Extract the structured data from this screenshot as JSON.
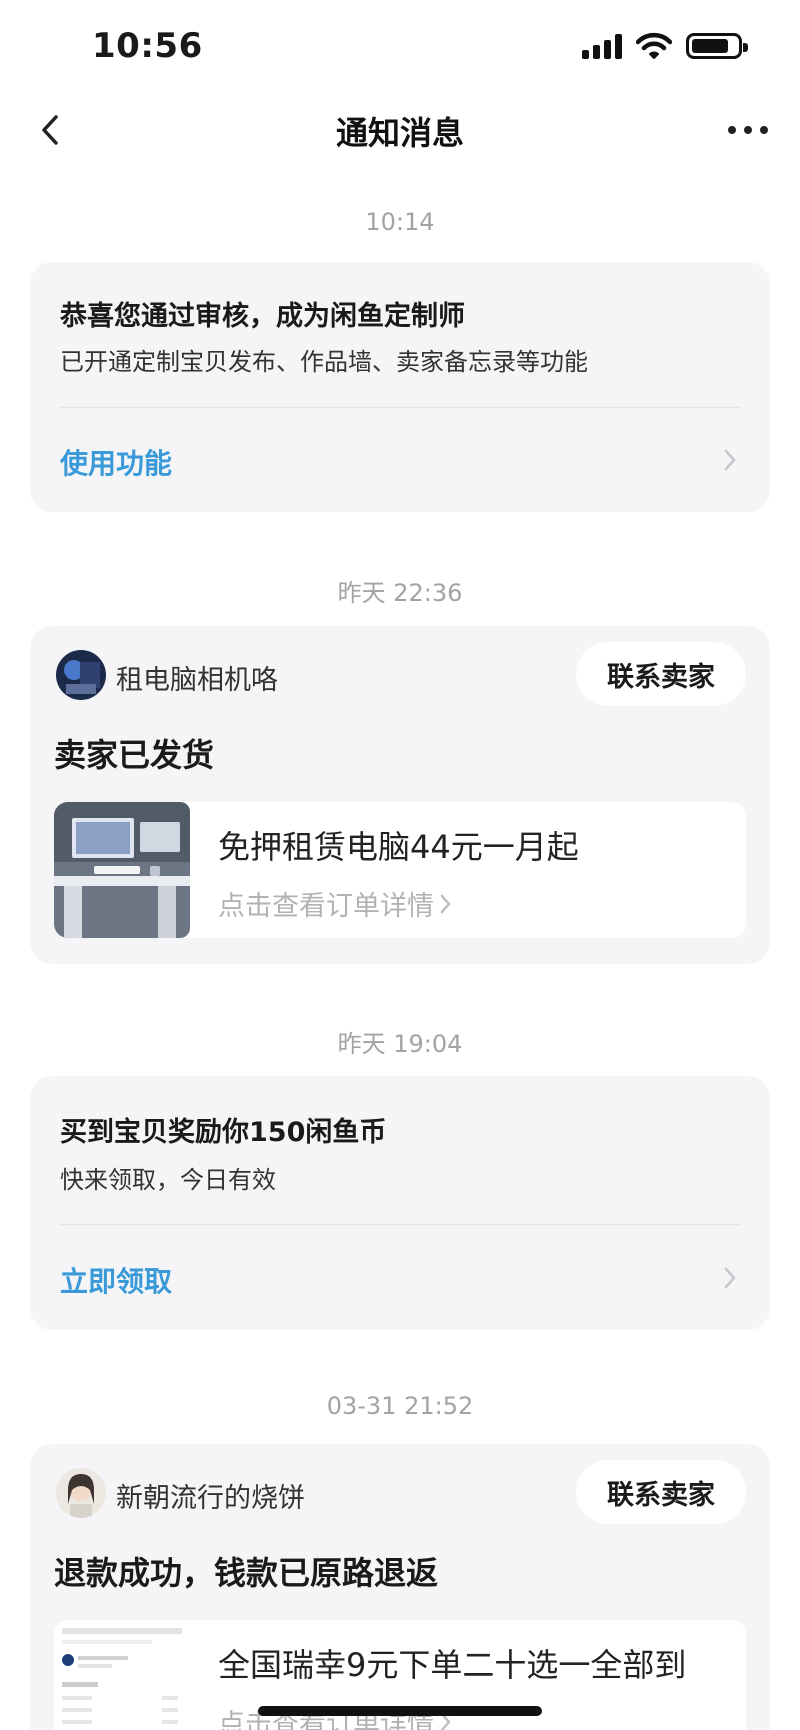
{
  "status_bar": {
    "time": "10:56"
  },
  "nav": {
    "title": "通知消息"
  },
  "messages": [
    {
      "time": "10:14",
      "title": "恭喜您通过审核，成为闲鱼定制师",
      "subtitle": "已开通定制宝贝发布、作品墙、卖家备忘录等功能",
      "action": "使用功能"
    },
    {
      "time": "昨天 22:36",
      "seller": "租电脑相机咯",
      "contact_label": "联系卖家",
      "title": "卖家已发货",
      "product_name": "免押租赁电脑44元一月起",
      "product_link": "点击查看订单详情"
    },
    {
      "time": "昨天 19:04",
      "title": "买到宝贝奖励你150闲鱼币",
      "subtitle": "快来领取，今日有效",
      "action": "立即领取"
    },
    {
      "time": "03-31 21:52",
      "seller": "新朝流行的烧饼",
      "contact_label": "联系卖家",
      "title": "退款成功，钱款已原路退返",
      "product_name": "全国瑞幸9元下单二十选一全部到",
      "product_link": "点击查看订单详情"
    }
  ],
  "colors": {
    "accent": "#3a9ad9",
    "card_bg": "#f5f5f7",
    "timestamp": "#a3a3a3"
  },
  "icons": [
    "back-arrow-icon",
    "more-icon",
    "chevron-right-icon",
    "signal-icon",
    "wifi-icon",
    "battery-icon"
  ]
}
